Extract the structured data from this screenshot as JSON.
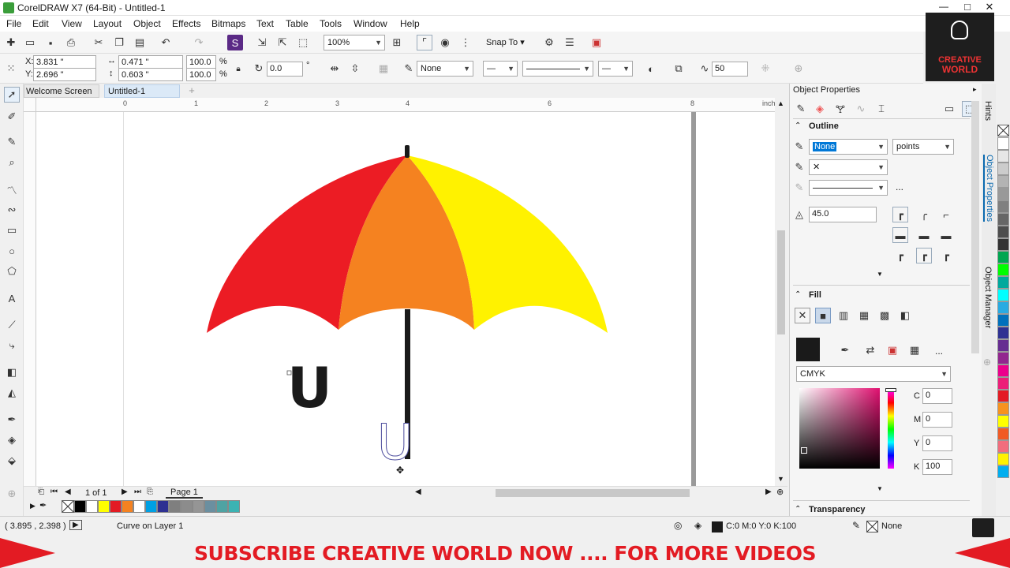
{
  "window": {
    "title": "CorelDRAW X7 (64-Bit) - Untitled-1",
    "min": "—",
    "max": "□",
    "close": "✕"
  },
  "menu": [
    "File",
    "Edit",
    "View",
    "Layout",
    "Object",
    "Effects",
    "Bitmaps",
    "Text",
    "Table",
    "Tools",
    "Window",
    "Help"
  ],
  "toolbar": {
    "zoom": "100%",
    "snap_label": "Snap To"
  },
  "propbar": {
    "x": "3.831 \"",
    "y": "2.696 \"",
    "w": "0.471 \"",
    "h": "0.603 \"",
    "sx": "100.0",
    "sy": "100.0",
    "pct": "%",
    "angle": "0.0",
    "deg": "°",
    "outline": "None",
    "nib": "50"
  },
  "tabs": [
    "Welcome Screen",
    "Untitled-1"
  ],
  "ruler": {
    "unit": "inches",
    "h_ticks": [
      "0",
      "1",
      "2",
      "3",
      "4",
      "6",
      "8"
    ]
  },
  "canvas": {
    "letter1": "U",
    "letter2": "U"
  },
  "pager": {
    "count": "1 of 1",
    "page": "Page 1"
  },
  "status": {
    "coords": "( 3.895 , 2.398 )",
    "info": "Curve on Layer 1",
    "fill": "C:0 M:0 Y:0 K:100",
    "outline": "None"
  },
  "docker": {
    "title": "Object Properties",
    "outline_section": "Outline",
    "outline_width": "None",
    "outline_unit": "points",
    "miter": "45.0",
    "ellipsis": "...",
    "fill_section": "Fill",
    "color_model": "CMYK",
    "c": "0",
    "m": "0",
    "y": "0",
    "k": "100",
    "c_label": "C",
    "m_label": "M",
    "y_label": "Y",
    "k_label": "K",
    "transparency_section": "Transparency",
    "side_tabs": [
      "Hints",
      "Object Properties",
      "Object Manager"
    ]
  },
  "logo": {
    "line1": "CREATIVE",
    "line2": "WORLD"
  },
  "banner": "SUBSCRIBE CREATIVE WORLD NOW .... FOR MORE VIDEOS",
  "colors": {
    "umbrella_red": "#ec1c24",
    "umbrella_orange": "#f58220",
    "umbrella_yellow": "#fff200",
    "banner_red": "#e31b23",
    "banner_text": "#e31b23",
    "accent": "#0078d7"
  },
  "palette_bottom": [
    "#000000",
    "#ffffff",
    "#ffff00",
    "#e31b23",
    "#f58220",
    "#ffffff",
    "#00a0e3",
    "#2e3192",
    "#7f7f7f",
    "#8c8c8c",
    "#959595",
    "#6b8fa0",
    "#4fa3a3",
    "#3cb3b3"
  ],
  "palette_right": [
    "#ffffff",
    "#e6e6e6",
    "#cccccc",
    "#b3b3b3",
    "#999999",
    "#808080",
    "#666666",
    "#4d4d4d",
    "#333333",
    "#00a651",
    "#00ff00",
    "#00a99d",
    "#00ffff",
    "#29abe2",
    "#0071bc",
    "#2e3192",
    "#662d91",
    "#92278f",
    "#ec008c",
    "#ed1e79",
    "#e31b23",
    "#f7931e",
    "#ffff00",
    "#f15a24",
    "#f26d7d",
    "#fff200",
    "#00aeef"
  ]
}
